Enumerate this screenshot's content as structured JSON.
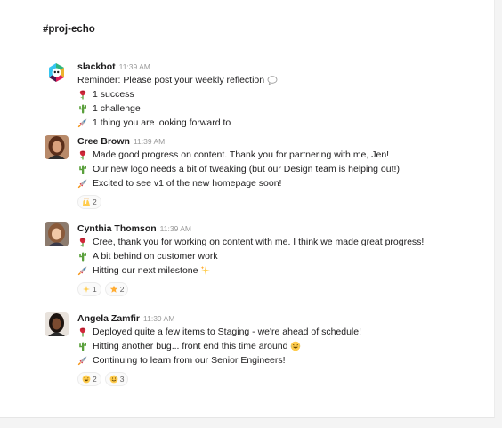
{
  "channel": {
    "name": "#proj-echo"
  },
  "messages": [
    {
      "author": "slackbot",
      "time": "11:39 AM",
      "avatar": "slackbot-logo",
      "lines": [
        {
          "icon": "",
          "text": "Reminder: Please post your weekly reflection",
          "trail": "speech-bubble-icon"
        },
        {
          "icon": "rose-icon",
          "text": "1 success"
        },
        {
          "icon": "cactus-icon",
          "text": "1 challenge"
        },
        {
          "icon": "rocket-icon",
          "text": "1 thing you are looking forward to"
        }
      ],
      "reactions": []
    },
    {
      "author": "Cree Brown",
      "time": "11:39 AM",
      "avatar": "user-photo",
      "lines": [
        {
          "icon": "rose-icon",
          "text": "Made good progress on content. Thank you for partnering with me, Jen!"
        },
        {
          "icon": "cactus-icon",
          "text": "Our new logo needs a bit of tweaking (but our Design team is helping out!)"
        },
        {
          "icon": "rocket-icon",
          "text": "Excited to see v1 of the new homepage soon!"
        }
      ],
      "reactions": [
        {
          "icon": "raised-hands-icon",
          "count": "2"
        }
      ]
    },
    {
      "author": "Cynthia Thomson",
      "time": "11:39 AM",
      "avatar": "user-photo",
      "lines": [
        {
          "icon": "rose-icon",
          "text": "Cree, thank you for working on content with me. I think we made great progress!"
        },
        {
          "icon": "cactus-icon",
          "text": "A bit behind on customer work"
        },
        {
          "icon": "rocket-icon",
          "text": "Hitting our next milestone",
          "trail": "sparkles-icon"
        }
      ],
      "reactions": [
        {
          "icon": "sparkles-icon",
          "count": "1"
        },
        {
          "icon": "star-icon",
          "count": "2"
        }
      ]
    },
    {
      "author": "Angela Zamfir",
      "time": "11:39 AM",
      "avatar": "user-photo",
      "lines": [
        {
          "icon": "rose-icon",
          "text": "Deployed quite a few items to Staging - we're ahead of schedule!"
        },
        {
          "icon": "cactus-icon",
          "text": "Hitting another bug... front end this time around",
          "trail": "laughing-face-icon"
        },
        {
          "icon": "rocket-icon",
          "text": "Continuing to learn from our Senior Engineers!"
        }
      ],
      "reactions": [
        {
          "icon": "laughing-face-icon",
          "count": "2"
        },
        {
          "icon": "sweat-smile-icon",
          "count": "3"
        }
      ]
    }
  ],
  "colors": {
    "text": "#1d1c1d",
    "timestamp": "#9a9a9a",
    "rose": "#d1283a",
    "cactus": "#5aa03c",
    "rocket": "#a7adb4"
  }
}
